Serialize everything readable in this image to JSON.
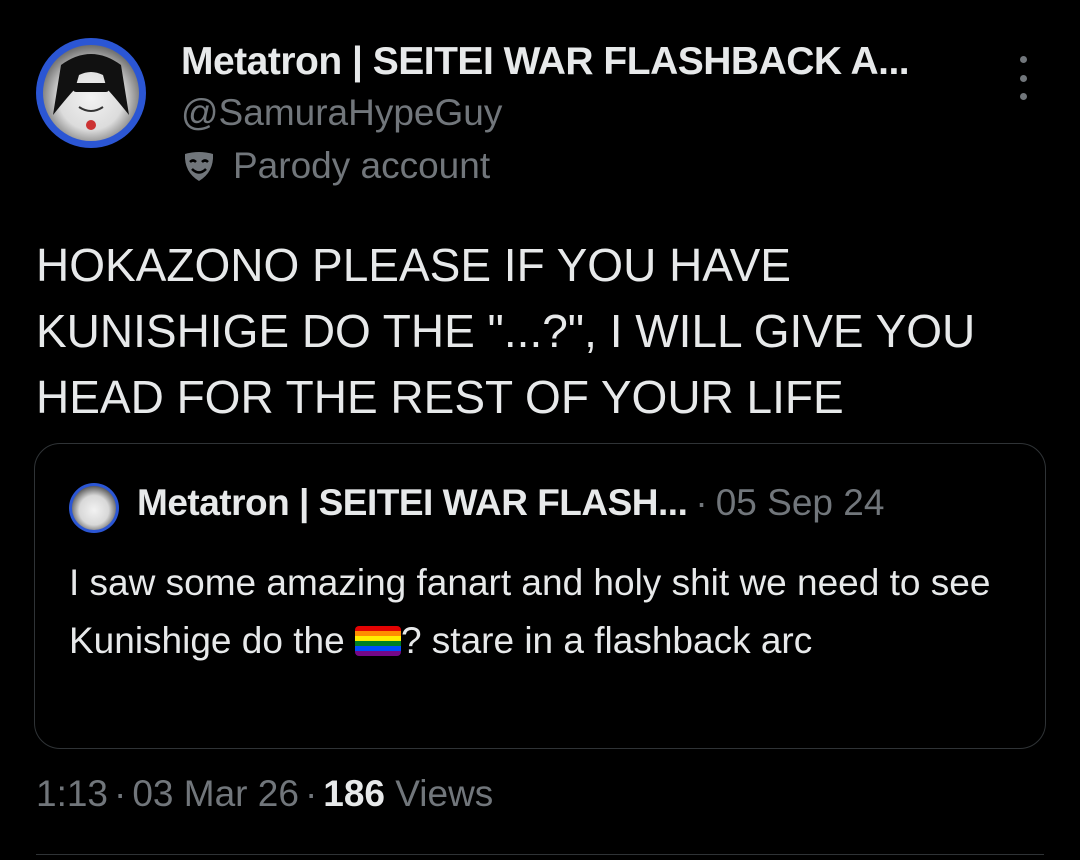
{
  "author": {
    "display_name": "Metatron | SEITEI WAR FLASHBACK A...",
    "handle": "@SamuraHypeGuy",
    "label": "Parody account",
    "label_icon": "mask-icon",
    "avatar_ring_color": "#2b56d4"
  },
  "tweet": {
    "text": "HOKAZONO PLEASE IF YOU HAVE\nKUNISHIGE DO THE \"...?\", I WILL GIVE YOU\nHEAD FOR THE REST OF YOUR LIFE"
  },
  "quoted": {
    "display_name": "Metatron | SEITEI WAR FLASH...",
    "separator": "·",
    "date": "05 Sep 24",
    "text_before_flag": "I saw some amazing fanart and holy shit we need to see Kunishige do the ",
    "flag_icon": "rainbow-flag-icon",
    "text_after_flag": "? stare in a flashback arc"
  },
  "meta": {
    "time": "1:13",
    "date": "03 Mar 26",
    "views_count": "186",
    "views_label": "Views",
    "separator": "·"
  },
  "colors": {
    "background": "#000000",
    "primary_text": "#e7e9ea",
    "secondary_text": "#71767b",
    "border": "#2f3336"
  }
}
